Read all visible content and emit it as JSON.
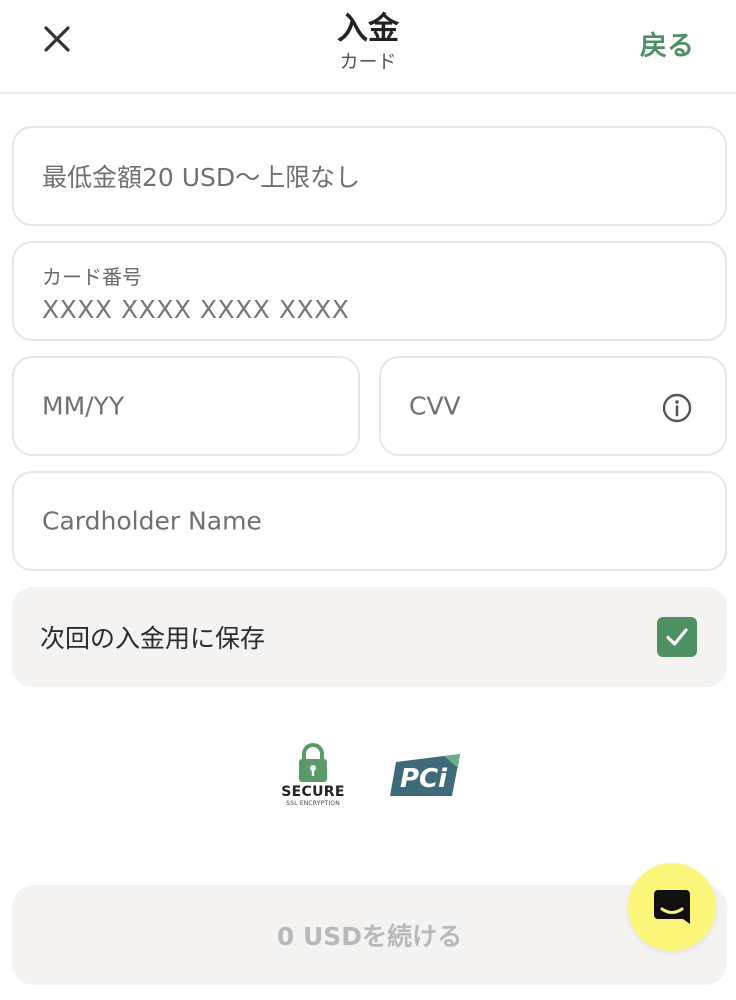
{
  "header": {
    "title": "入金",
    "subtitle": "カード",
    "back_label": "戻る"
  },
  "form": {
    "amount_placeholder": "最低金額20 USD〜上限なし",
    "card_number_label": "カード番号",
    "card_number_placeholder": "XXXX XXXX XXXX XXXX",
    "expiry_placeholder": "MM/YY",
    "cvv_placeholder": "CVV",
    "cardholder_placeholder": "Cardholder Name",
    "save_label": "次回の入金用に保存",
    "save_checked": true
  },
  "badges": {
    "secure_title": "SECURE",
    "secure_subtitle": "SSL ENCRYPTION",
    "pci_label": "PCi"
  },
  "footer": {
    "submit_label": "0 USDを続ける"
  },
  "colors": {
    "accent": "#4f8f64",
    "chat_button": "#fbf67a",
    "pci": "#3f6b78"
  },
  "icons": {
    "close": "close-icon",
    "info": "info-icon",
    "check": "checkmark-icon",
    "lock": "lock-icon",
    "chat": "chat-icon"
  }
}
